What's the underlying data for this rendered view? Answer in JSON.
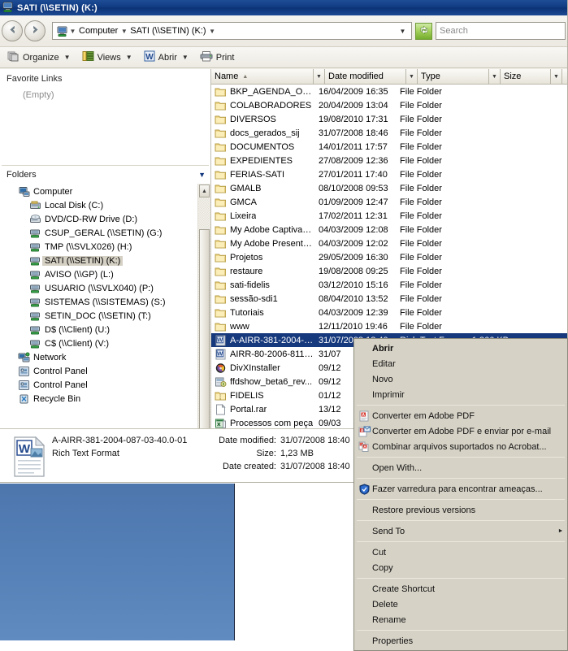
{
  "window": {
    "title": "SATI (\\\\SETIN) (K:)",
    "title_icon": "network-drive-icon"
  },
  "nav": {
    "back_icon": "back-arrow-icon",
    "forward_icon": "forward-arrow-icon",
    "address_icon": "network-drive-icon",
    "breadcrumbs": [
      "Computer",
      "SATI (\\\\SETIN) (K:)"
    ],
    "dropdown_icon": "chevron-down-icon",
    "refresh_icon": "refresh-icon",
    "search_placeholder": "Search"
  },
  "toolbar": {
    "items": [
      {
        "label": "Organize",
        "icon": "organize-icon",
        "caret": true
      },
      {
        "label": "Views",
        "icon": "views-icon",
        "caret": true
      },
      {
        "label": "Abrir",
        "icon": "word-icon",
        "caret": true
      },
      {
        "label": "Print",
        "icon": "printer-icon",
        "caret": false
      }
    ]
  },
  "navpane": {
    "favorites_title": "Favorite Links",
    "favorites_empty": "(Empty)",
    "folders_title": "Folders",
    "folders_chevron": "chevron-down-icon",
    "tree": [
      {
        "label": "Computer",
        "icon": "computer-icon",
        "indent": 1,
        "selected": false
      },
      {
        "label": "Local Disk (C:)",
        "icon": "harddisk-icon",
        "indent": 2,
        "selected": false
      },
      {
        "label": "DVD/CD-RW Drive (D:)",
        "icon": "optical-drive-icon",
        "indent": 2,
        "selected": false
      },
      {
        "label": "CSUP_GERAL (\\\\SETIN) (G:)",
        "icon": "network-drive-icon",
        "indent": 2,
        "selected": false
      },
      {
        "label": "TMP (\\\\SVLX026) (H:)",
        "icon": "network-drive-icon",
        "indent": 2,
        "selected": false
      },
      {
        "label": "SATI (\\\\SETIN) (K:)",
        "icon": "network-drive-icon",
        "indent": 2,
        "selected": true
      },
      {
        "label": "AVISO (\\\\GP) (L:)",
        "icon": "network-drive-icon",
        "indent": 2,
        "selected": false
      },
      {
        "label": "USUARIO (\\\\SVLX040) (P:)",
        "icon": "network-drive-icon",
        "indent": 2,
        "selected": false
      },
      {
        "label": "SISTEMAS (\\\\SISTEMAS) (S:)",
        "icon": "network-drive-icon",
        "indent": 2,
        "selected": false
      },
      {
        "label": "SETIN_DOC (\\\\SETIN) (T:)",
        "icon": "network-drive-icon",
        "indent": 2,
        "selected": false
      },
      {
        "label": "D$ (\\\\Client) (U:)",
        "icon": "network-drive-icon",
        "indent": 2,
        "selected": false
      },
      {
        "label": "C$ (\\\\Client) (V:)",
        "icon": "network-drive-icon",
        "indent": 2,
        "selected": false
      },
      {
        "label": "Network",
        "icon": "network-icon",
        "indent": 1,
        "selected": false
      },
      {
        "label": "Control Panel",
        "icon": "control-panel-icon",
        "indent": 1,
        "selected": false
      },
      {
        "label": "Control Panel",
        "icon": "control-panel-icon",
        "indent": 1,
        "selected": false
      },
      {
        "label": "Recycle Bin",
        "icon": "recycle-bin-icon",
        "indent": 1,
        "selected": false
      }
    ]
  },
  "filelist": {
    "columns": [
      {
        "label": "Name",
        "sorted": true,
        "sort_icon": "sort-asc-icon"
      },
      {
        "label": "Date modified",
        "sorted": false
      },
      {
        "label": "Type",
        "sorted": false
      },
      {
        "label": "Size",
        "sorted": false
      }
    ],
    "rows": [
      {
        "name": "BKP_AGENDA_OLD",
        "date": "16/04/2009 16:35",
        "type": "File Folder",
        "size": "",
        "icon": "folder-icon",
        "selected": false
      },
      {
        "name": "COLABORADORES",
        "date": "20/04/2009 13:04",
        "type": "File Folder",
        "size": "",
        "icon": "folder-icon",
        "selected": false
      },
      {
        "name": "DIVERSOS",
        "date": "19/08/2010 17:31",
        "type": "File Folder",
        "size": "",
        "icon": "folder-icon",
        "selected": false
      },
      {
        "name": "docs_gerados_sij",
        "date": "31/07/2008 18:46",
        "type": "File Folder",
        "size": "",
        "icon": "folder-icon",
        "selected": false
      },
      {
        "name": "DOCUMENTOS",
        "date": "14/01/2011 17:57",
        "type": "File Folder",
        "size": "",
        "icon": "folder-icon",
        "selected": false
      },
      {
        "name": "EXPEDIENTES",
        "date": "27/08/2009 12:36",
        "type": "File Folder",
        "size": "",
        "icon": "folder-icon",
        "selected": false
      },
      {
        "name": "FERIAS-SATI",
        "date": "27/01/2011 17:40",
        "type": "File Folder",
        "size": "",
        "icon": "folder-icon",
        "selected": false
      },
      {
        "name": "GMALB",
        "date": "08/10/2008 09:53",
        "type": "File Folder",
        "size": "",
        "icon": "folder-icon",
        "selected": false
      },
      {
        "name": "GMCA",
        "date": "01/09/2009 12:47",
        "type": "File Folder",
        "size": "",
        "icon": "folder-icon",
        "selected": false
      },
      {
        "name": "Lixeira",
        "date": "17/02/2011 12:31",
        "type": "File Folder",
        "size": "",
        "icon": "folder-icon",
        "selected": false
      },
      {
        "name": "My Adobe Captivate...",
        "date": "04/03/2009 12:08",
        "type": "File Folder",
        "size": "",
        "icon": "folder-icon",
        "selected": false
      },
      {
        "name": "My Adobe Presentati...",
        "date": "04/03/2009 12:02",
        "type": "File Folder",
        "size": "",
        "icon": "folder-icon",
        "selected": false
      },
      {
        "name": "Projetos",
        "date": "29/05/2009 16:30",
        "type": "File Folder",
        "size": "",
        "icon": "folder-icon",
        "selected": false
      },
      {
        "name": "restaure",
        "date": "19/08/2008 09:25",
        "type": "File Folder",
        "size": "",
        "icon": "folder-icon",
        "selected": false
      },
      {
        "name": "sati-fidelis",
        "date": "03/12/2010 15:16",
        "type": "File Folder",
        "size": "",
        "icon": "folder-icon",
        "selected": false
      },
      {
        "name": "sessão-sdi1",
        "date": "08/04/2010 13:52",
        "type": "File Folder",
        "size": "",
        "icon": "folder-icon",
        "selected": false
      },
      {
        "name": "Tutoriais",
        "date": "04/03/2009 12:39",
        "type": "File Folder",
        "size": "",
        "icon": "folder-icon",
        "selected": false
      },
      {
        "name": "www",
        "date": "12/11/2010 19:46",
        "type": "File Folder",
        "size": "",
        "icon": "folder-icon",
        "selected": false
      },
      {
        "name": "A-AIRR-381-2004-0...",
        "date": "31/07/2008 18:40",
        "type": "Rich Text Format",
        "size": "1.266 KB",
        "icon": "word-doc-icon",
        "selected": true
      },
      {
        "name": "AIRR-80-2006-811-...",
        "date": "31/07",
        "type": "",
        "size": "",
        "icon": "word-doc-icon",
        "selected": false
      },
      {
        "name": "DivXInstaller",
        "date": "09/12",
        "type": "",
        "size": "",
        "icon": "divx-icon",
        "selected": false
      },
      {
        "name": "ffdshow_beta6_rev...",
        "date": "09/12",
        "type": "",
        "size": "",
        "icon": "setup-icon",
        "selected": false
      },
      {
        "name": "FIDELIS",
        "date": "01/12",
        "type": "",
        "size": "",
        "icon": "zip-icon",
        "selected": false
      },
      {
        "name": "Portal.rar",
        "date": "13/12",
        "type": "",
        "size": "",
        "icon": "generic-file-icon",
        "selected": false
      },
      {
        "name": "Processos com peça",
        "date": "09/03",
        "type": "",
        "size": "",
        "icon": "excel-icon",
        "selected": false
      }
    ]
  },
  "details": {
    "icon": "rtf-document-icon",
    "filename": "A-AIRR-381-2004-087-03-40.0-01",
    "filetype": "Rich Text Format",
    "fields": [
      {
        "label": "Date modified:",
        "value": "31/07/2008 18:40"
      },
      {
        "label": "Size:",
        "value": "1,23 MB"
      },
      {
        "label": "Date created:",
        "value": "31/07/2008 18:40"
      }
    ]
  },
  "context_menu": {
    "items": [
      {
        "label": "Abrir",
        "bold": true,
        "icon": null,
        "separator_after": false
      },
      {
        "label": "Editar",
        "bold": false,
        "icon": null,
        "separator_after": false
      },
      {
        "label": "Novo",
        "bold": false,
        "icon": null,
        "separator_after": false
      },
      {
        "label": "Imprimir",
        "bold": false,
        "icon": null,
        "separator_after": true
      },
      {
        "label": "Converter em Adobe PDF",
        "bold": false,
        "icon": "adobe-pdf-icon",
        "separator_after": false
      },
      {
        "label": "Converter em Adobe PDF e enviar por e-mail",
        "bold": false,
        "icon": "adobe-pdf-mail-icon",
        "separator_after": false
      },
      {
        "label": "Combinar arquivos suportados no Acrobat...",
        "bold": false,
        "icon": "adobe-combine-icon",
        "separator_after": true
      },
      {
        "label": "Open With...",
        "bold": false,
        "icon": null,
        "separator_after": true
      },
      {
        "label": "Fazer varredura para encontrar ameaças...",
        "bold": false,
        "icon": "shield-icon",
        "separator_after": true
      },
      {
        "label": "Restore previous versions",
        "bold": false,
        "icon": null,
        "separator_after": true
      },
      {
        "label": "Send To",
        "bold": false,
        "icon": null,
        "submenu": true,
        "separator_after": true
      },
      {
        "label": "Cut",
        "bold": false,
        "icon": null,
        "separator_after": false
      },
      {
        "label": "Copy",
        "bold": false,
        "icon": null,
        "separator_after": true
      },
      {
        "label": "Create Shortcut",
        "bold": false,
        "icon": null,
        "separator_after": false
      },
      {
        "label": "Delete",
        "bold": false,
        "icon": null,
        "separator_after": false
      },
      {
        "label": "Rename",
        "bold": false,
        "icon": null,
        "separator_after": true
      },
      {
        "label": "Properties",
        "bold": false,
        "icon": null,
        "separator_after": false
      }
    ]
  },
  "colors": {
    "titlebar": "#113c83",
    "selection": "#16387c",
    "menu_bg": "#d6d2c6",
    "desktop": "#5581b8"
  }
}
